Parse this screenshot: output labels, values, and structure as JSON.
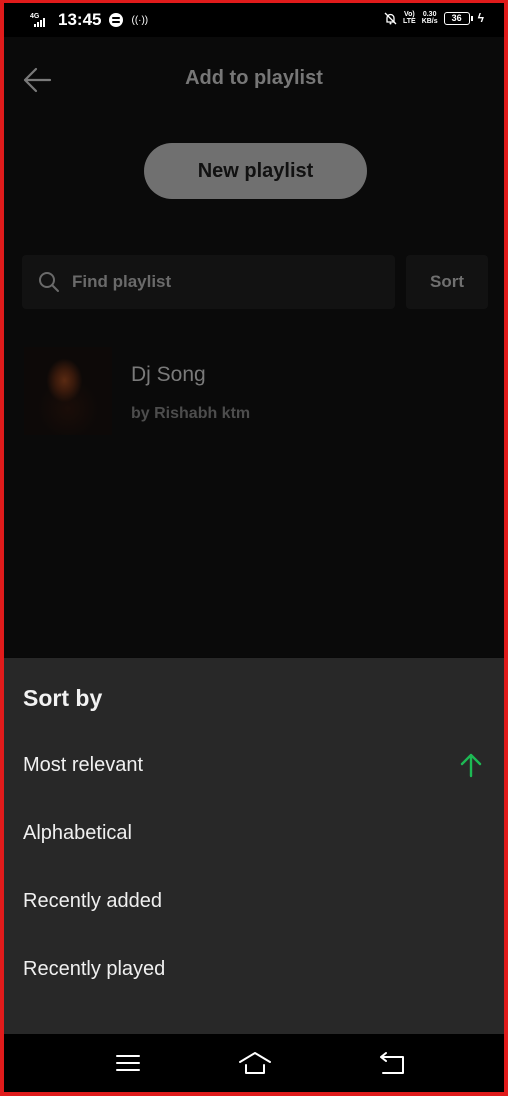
{
  "status_bar": {
    "network": "4G",
    "time": "13:45",
    "volte_top": "Vo)",
    "volte_bottom": "LTE",
    "speed_value": "0.30",
    "speed_unit": "KB/s",
    "battery": "36"
  },
  "header": {
    "title": "Add to playlist"
  },
  "new_playlist_label": "New playlist",
  "search": {
    "placeholder": "Find playlist",
    "value": ""
  },
  "sort_label": "Sort",
  "playlists": [
    {
      "title": "Dj Song",
      "subtitle": "by Rishabh ktm"
    }
  ],
  "sort_sheet": {
    "title": "Sort by",
    "options": [
      {
        "label": "Most relevant",
        "selected": true,
        "direction": "ascending"
      },
      {
        "label": "Alphabetical",
        "selected": false
      },
      {
        "label": "Recently added",
        "selected": false
      },
      {
        "label": "Recently played",
        "selected": false
      }
    ],
    "accent_color": "#1db954"
  }
}
